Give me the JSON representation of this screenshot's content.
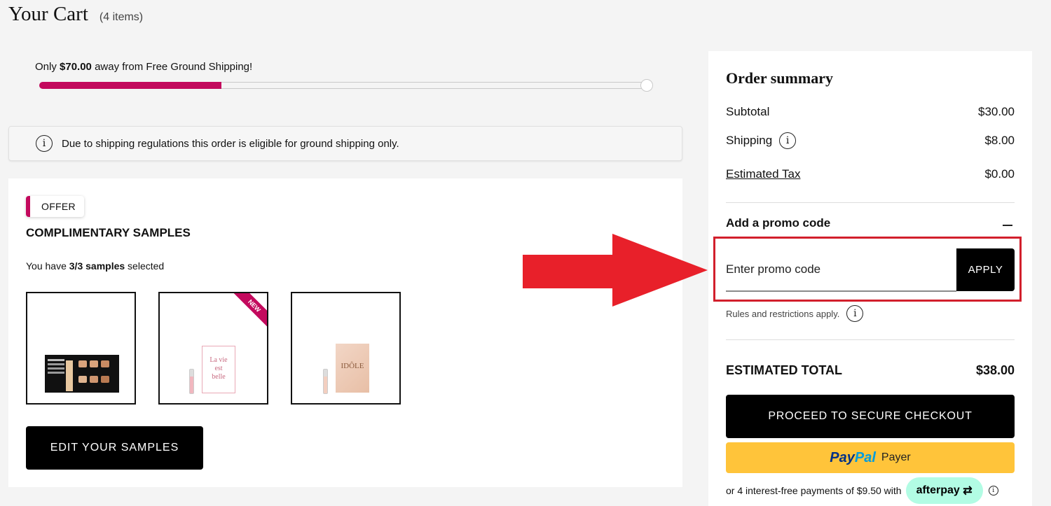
{
  "header": {
    "title": "Your Cart",
    "item_count": "(4 items)"
  },
  "shipping_progress": {
    "text_prefix": "Only ",
    "amount": "$70.00",
    "text_suffix": " away from Free Ground Shipping!",
    "progress_fraction": 0.3
  },
  "notice": {
    "icon": "info-icon",
    "text": "Due to shipping regulations this order is eligible for ground shipping only."
  },
  "samples": {
    "badge": "OFFER",
    "title": "COMPLIMENTARY SAMPLES",
    "count_prefix": "You have ",
    "count": "3/3 samples",
    "count_suffix": " selected",
    "tiles": [
      {
        "icon": "foundation-palette-image"
      },
      {
        "icon": "la-vie-est-belle-sample-image",
        "ribbon": "NEW",
        "card_text": [
          "La vie",
          "est",
          "belle"
        ]
      },
      {
        "icon": "idole-sample-image",
        "card_text": [
          "IDÔLE"
        ]
      }
    ],
    "edit_button": "EDIT YOUR SAMPLES"
  },
  "summary": {
    "title": "Order summary",
    "subtotal_label": "Subtotal",
    "subtotal_value": "$30.00",
    "shipping_label": "Shipping",
    "shipping_value": "$8.00",
    "tax_label": "Estimated Tax",
    "tax_value": "$0.00",
    "promo_heading": "Add a promo code",
    "promo_placeholder": "Enter promo code",
    "apply_button": "APPLY",
    "rules_text": "Rules and restrictions apply.",
    "total_label": "ESTIMATED TOTAL",
    "total_value": "$38.00",
    "checkout_button": "PROCEED TO SECURE CHECKOUT",
    "paypal_logo_a": "Pay",
    "paypal_logo_b": "Pal",
    "paypal_label": "Payer",
    "afterpay_text": "or 4 interest-free payments of $9.50 with",
    "afterpay_brand": "afterpay"
  },
  "colors": {
    "brand_pink": "#c3095d",
    "highlight_red": "#d21f2c",
    "paypal_yellow": "#ffc43a",
    "afterpay_mint": "#b2fce4"
  }
}
